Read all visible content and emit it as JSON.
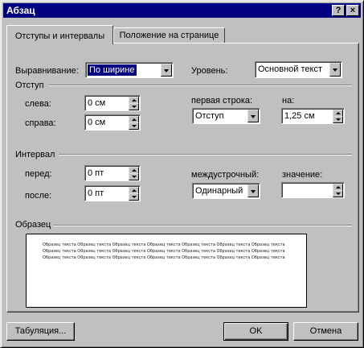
{
  "window": {
    "title": "Абзац"
  },
  "titlebar": {
    "help_label": "?",
    "close_label": "×"
  },
  "tabs": [
    {
      "label": "Отступы и интервалы",
      "active": true
    },
    {
      "label": "Положение на странице",
      "active": false
    }
  ],
  "alignment": {
    "label": "Выравнивание:",
    "value": "По ширине"
  },
  "level": {
    "label": "Уровень:",
    "value": "Основной текст"
  },
  "indent": {
    "group_label": "Отступ",
    "left_label": "слева:",
    "left_value": "0 см",
    "right_label": "справа:",
    "right_value": "0 см",
    "first_line_label": "первая строка:",
    "first_line_value": "Отступ",
    "by_label": "на:",
    "by_value": "1,25 см"
  },
  "spacing": {
    "group_label": "Интервал",
    "before_label": "перед:",
    "before_value": "0 пт",
    "after_label": "после:",
    "after_value": "0 пт",
    "line_label": "междустрочный:",
    "line_value": "Одинарный",
    "at_label": "значение:",
    "at_value": ""
  },
  "preview": {
    "group_label": "Образец",
    "sample_text": "Образец текста Образец текста Образец текста Образец текста Образец текста Образец текста Образец текста Образец текста Образец текста Образец текста Образец текста Образец текста Образец текста Образец текста Образец текста Образец текста Образец текста Образец текста Образец текста Образец текста Образец текста"
  },
  "buttons": {
    "tabs_label": "Табуляция...",
    "ok_label": "OK",
    "cancel_label": "Отмена"
  }
}
